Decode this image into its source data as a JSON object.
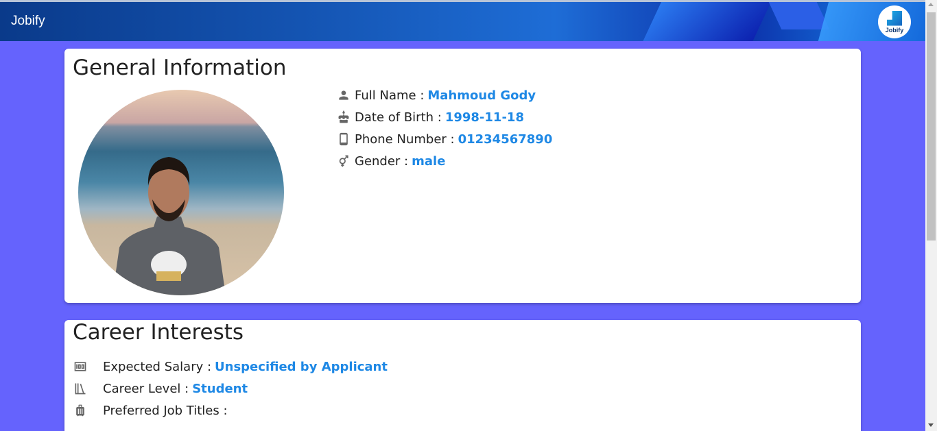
{
  "app": {
    "title": "Jobify",
    "logo_text": "Jobify"
  },
  "general": {
    "title": "General Information",
    "fields": [
      {
        "icon": "person-icon",
        "label": "Full Name :",
        "value": "Mahmoud Gody"
      },
      {
        "icon": "cake-icon",
        "label": "Date of Birth :",
        "value": "1998-11-18"
      },
      {
        "icon": "phone-icon",
        "label": "Phone Number :",
        "value": "01234567890"
      },
      {
        "icon": "gender-icon",
        "label": "Gender :",
        "value": "male"
      }
    ]
  },
  "career": {
    "title": "Career Interests",
    "fields": [
      {
        "icon": "money-icon",
        "label": "Expected Salary :",
        "value": "Unspecified by Applicant"
      },
      {
        "icon": "books-icon",
        "label": "Career Level :",
        "value": "Student"
      },
      {
        "icon": "briefcase-icon",
        "label": "Preferred Job Titles :",
        "value": ""
      }
    ]
  },
  "colors": {
    "background": "#6563fd",
    "accent": "#1e88e5"
  }
}
